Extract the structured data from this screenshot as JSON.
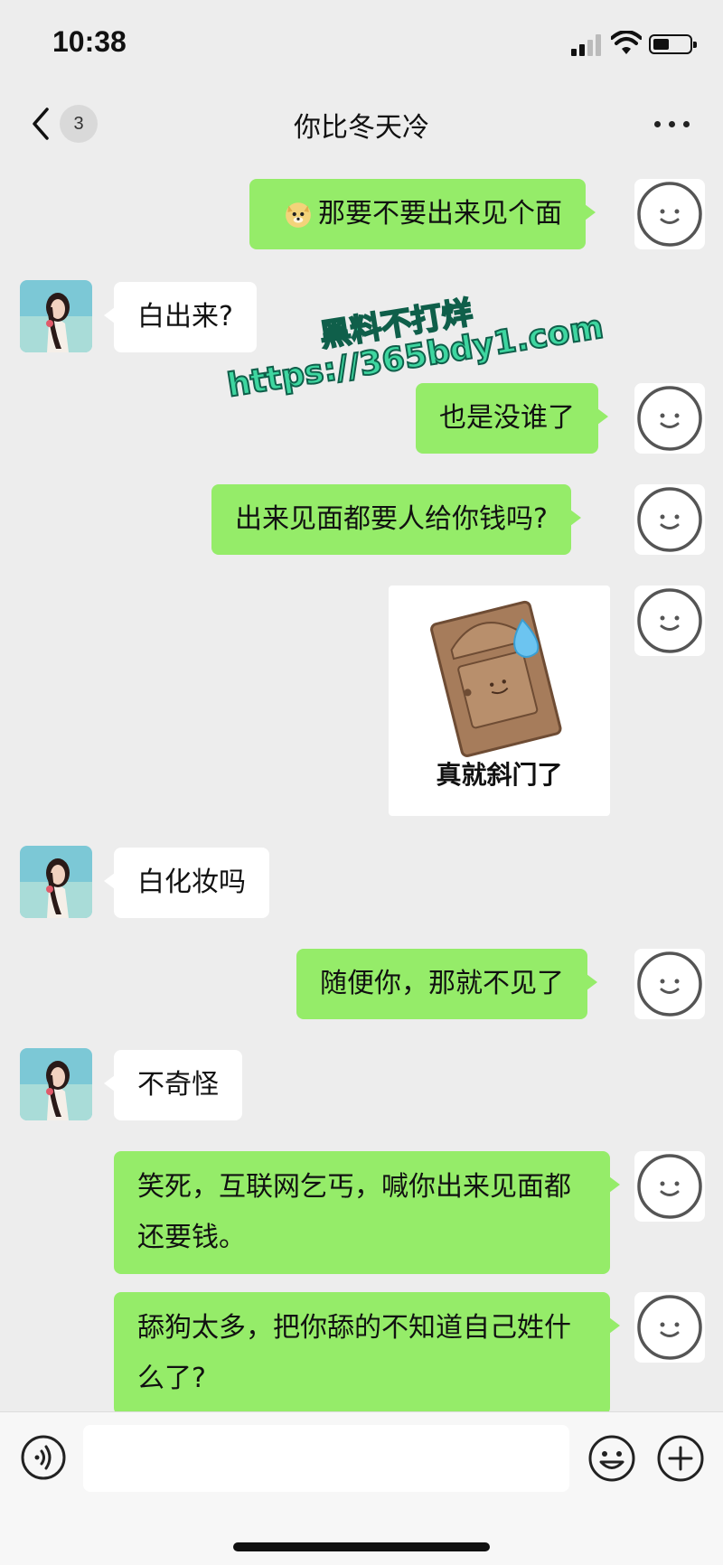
{
  "status_bar": {
    "time": "10:38"
  },
  "nav": {
    "unread_count": "3",
    "title": "你比冬天冷"
  },
  "messages": [
    {
      "from": "me",
      "emoji": "doge",
      "text": "那要不要出来见个面"
    },
    {
      "from": "her",
      "text": "白出来?"
    },
    {
      "from": "me",
      "text": "也是没谁了"
    },
    {
      "from": "me",
      "text": "出来见面都要人给你钱吗?"
    },
    {
      "from": "me",
      "type": "sticker",
      "sticker_caption": "真就斜门了"
    },
    {
      "from": "her",
      "text": "白化妆吗"
    },
    {
      "from": "me",
      "text": "随便你，那就不见了"
    },
    {
      "from": "her",
      "text": "不奇怪"
    },
    {
      "from": "me",
      "text": "笑死，互联网乞丐，喊你出来见面都还要钱。"
    },
    {
      "from": "me",
      "text": "舔狗太多，把你舔的不知道自己姓什么了?"
    }
  ],
  "watermark": {
    "line1": "黑料不打烊",
    "line2": "https://365bdy1.com"
  },
  "input": {
    "value": ""
  },
  "icons": {
    "back": "chevron-left-icon",
    "more": "more-dots-icon",
    "voice": "voice-icon",
    "emoji": "emoji-icon",
    "plus": "plus-icon"
  },
  "colors": {
    "outgoing_bubble": "#95ec69",
    "incoming_bubble": "#ffffff",
    "background": "#ededed"
  }
}
